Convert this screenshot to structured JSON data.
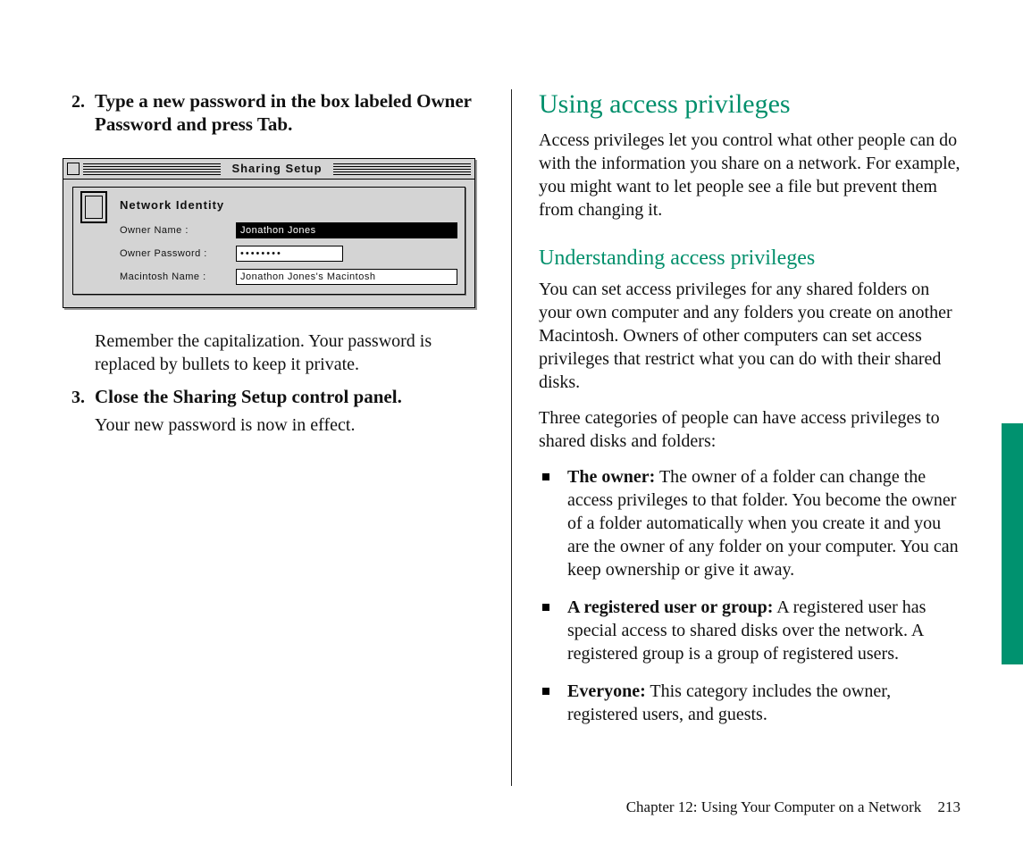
{
  "left": {
    "steps": [
      {
        "num": "2.",
        "head": "Type a new password in the box labeled Owner Password and press Tab.",
        "body_after_image": "Remember the capitalization. Your password is replaced by bullets to keep it private."
      },
      {
        "num": "3.",
        "head": "Close the Sharing Setup control panel.",
        "body": "Your new password is now in effect."
      }
    ],
    "screenshot": {
      "title": "Sharing Setup",
      "section_title": "Network Identity",
      "rows": {
        "owner_name_label": "Owner Name :",
        "owner_name_value": "Jonathon Jones",
        "owner_password_label": "Owner Password :",
        "owner_password_value": "••••••••",
        "mac_name_label": "Macintosh Name :",
        "mac_name_value": "Jonathon Jones's Macintosh"
      }
    }
  },
  "right": {
    "h1": "Using access privileges",
    "p1": "Access privileges let you control what other people can do with the information you share on a network. For example, you might want to let people see a file but prevent them from changing it.",
    "h2": "Understanding access privileges",
    "p2": "You can set access privileges for any shared folders on your own computer and any folders you create on another Macintosh. Owners of other computers can set access privileges that restrict what you can do with their shared disks.",
    "p3": "Three categories of people can have access privileges to shared disks and folders:",
    "bullets": [
      {
        "term": "The owner:",
        "text": "  The owner of a folder can change the access privileges to that folder. You become the owner of a folder automatically when you create it and you are the owner of any folder on your computer. You can keep ownership or give it away."
      },
      {
        "term": "A registered user or group:",
        "text": "  A registered user has special access to shared disks over the network. A registered group is a group of registered users."
      },
      {
        "term": "Everyone:",
        "text": "  This category includes the owner, registered users, and guests."
      }
    ]
  },
  "footer": {
    "chapter": "Chapter 12: Using Your Computer on a Network",
    "page": "213"
  }
}
